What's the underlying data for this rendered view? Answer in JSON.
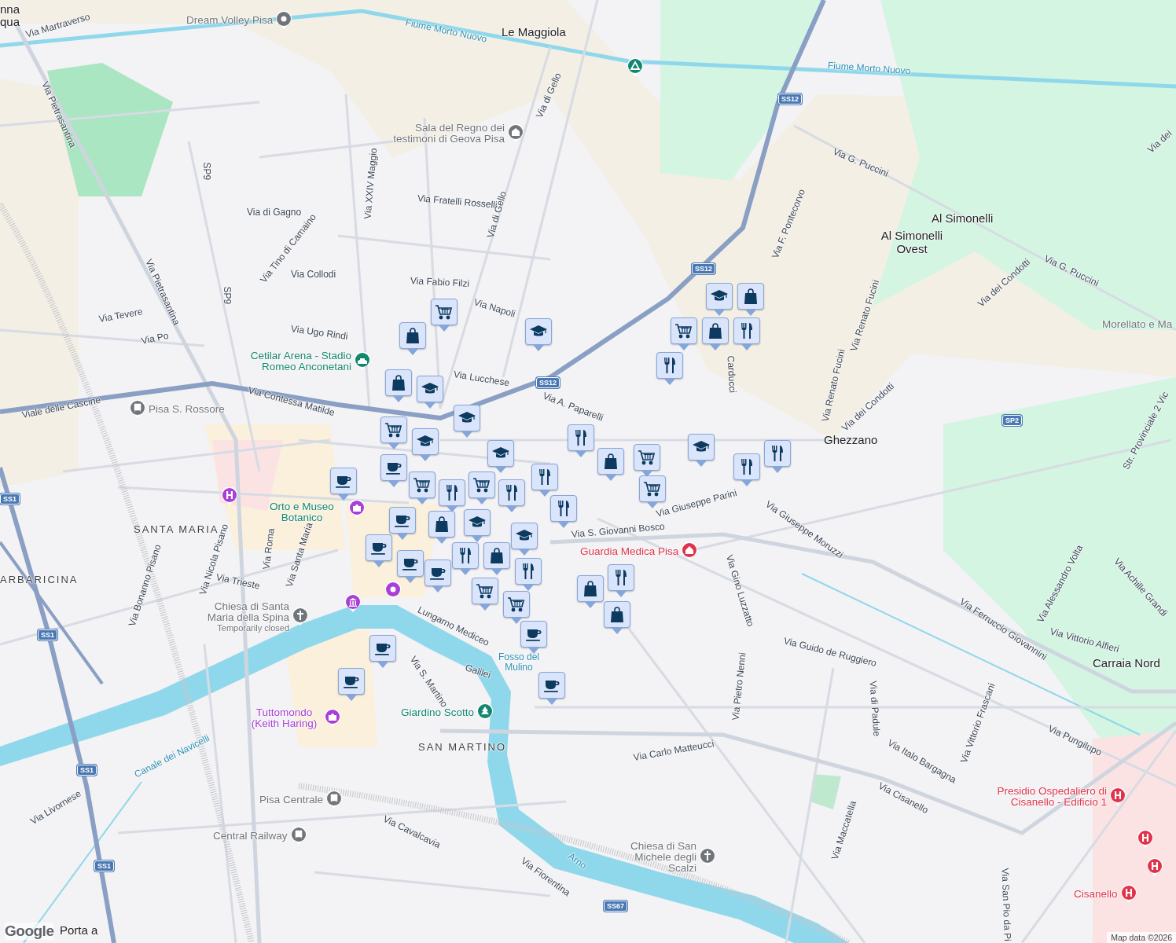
{
  "map": {
    "labels": [
      {
        "text": "Via Martraverso",
        "kind": "street"
      },
      {
        "text": "Via Pietrasantina",
        "kind": "street"
      },
      {
        "text": "SP9",
        "kind": "street"
      },
      {
        "text": "Via di Gagno",
        "kind": "street"
      },
      {
        "text": "Via Tino di Camaino",
        "kind": "street"
      },
      {
        "text": "SP9",
        "kind": "street"
      },
      {
        "text": "Via Collodi",
        "kind": "street"
      },
      {
        "text": "Via Pietrasantina",
        "kind": "street"
      },
      {
        "text": "Via Tevere",
        "kind": "street"
      },
      {
        "text": "Via Po",
        "kind": "street"
      },
      {
        "text": "Via Ugo Rindi",
        "kind": "street"
      },
      {
        "text": "Via XXIV Maggio",
        "kind": "street"
      },
      {
        "text": "Via Fratelli Rosselli",
        "kind": "street"
      },
      {
        "text": "Via Fabio Filzi",
        "kind": "street"
      },
      {
        "text": "Via di Gello",
        "kind": "street"
      },
      {
        "text": "Via di Gello",
        "kind": "street"
      },
      {
        "text": "Via Napoli",
        "kind": "street"
      },
      {
        "text": "Via Lucchese",
        "kind": "street"
      },
      {
        "text": "Via Contessa Matilde",
        "kind": "street"
      },
      {
        "text": "Viale delle Cascine",
        "kind": "street"
      },
      {
        "text": "Via A. Paparelli",
        "kind": "street"
      },
      {
        "text": "Via G. Puccini",
        "kind": "street"
      },
      {
        "text": "Via F. Pontecorvo",
        "kind": "street"
      },
      {
        "text": "Via Renato Fucini",
        "kind": "street"
      },
      {
        "text": "Via Renato Fucini",
        "kind": "street"
      },
      {
        "text": "Via dei Condotti",
        "kind": "street"
      },
      {
        "text": "Via dei Condotti",
        "kind": "street"
      },
      {
        "text": "Via G. Puccini",
        "kind": "street"
      },
      {
        "text": "Via dei",
        "kind": "street"
      },
      {
        "text": "Str. Provinciale 2 Vic",
        "kind": "street"
      },
      {
        "text": "Carducci",
        "kind": "street"
      },
      {
        "text": "Via Giuseppe Parini",
        "kind": "street"
      },
      {
        "text": "Via S. Giovanni Bosco",
        "kind": "street"
      },
      {
        "text": "Via Giuseppe Moruzzi",
        "kind": "street"
      },
      {
        "text": "Via Gino Luzzatto",
        "kind": "street"
      },
      {
        "text": "Via Pietro Nenni",
        "kind": "street"
      },
      {
        "text": "Via Guido de Ruggiero",
        "kind": "street"
      },
      {
        "text": "Via di Padule",
        "kind": "street"
      },
      {
        "text": "Via Ferruccio Giovannini",
        "kind": "street"
      },
      {
        "text": "Via Alessandro Volta",
        "kind": "street"
      },
      {
        "text": "Via Achille Grandi",
        "kind": "street"
      },
      {
        "text": "Via Vittorio Alfieri",
        "kind": "street"
      },
      {
        "text": "Via Vittorio Frascani",
        "kind": "street"
      },
      {
        "text": "Via Pungilupo",
        "kind": "street"
      },
      {
        "text": "Via Italo Bargagna",
        "kind": "street"
      },
      {
        "text": "Via Carlo Matteucci",
        "kind": "street"
      },
      {
        "text": "Via Cisanello",
        "kind": "street"
      },
      {
        "text": "Via Maccatella",
        "kind": "street"
      },
      {
        "text": "Via San Pio da Pi",
        "kind": "street"
      },
      {
        "text": "Via Bonanno Pisano",
        "kind": "street"
      },
      {
        "text": "Via Nicola Pisano",
        "kind": "street"
      },
      {
        "text": "Via Roma",
        "kind": "street"
      },
      {
        "text": "Via Santa Maria",
        "kind": "street"
      },
      {
        "text": "Via Trieste",
        "kind": "street"
      },
      {
        "text": "Lungarno Mediceo",
        "kind": "street"
      },
      {
        "text": "Galilei",
        "kind": "street"
      },
      {
        "text": "Via S. Martino",
        "kind": "street"
      },
      {
        "text": "Via Livornese",
        "kind": "street"
      },
      {
        "text": "Via Cavalcavia",
        "kind": "street"
      },
      {
        "text": "Via Fiorentina",
        "kind": "street"
      },
      {
        "text": "Canale dei Navicelli",
        "kind": "water"
      },
      {
        "text": "Arno",
        "kind": "water"
      },
      {
        "text": "Fiume Morto Nuovo",
        "kind": "water"
      },
      {
        "text": "Fiume Morto Nuovo",
        "kind": "water"
      },
      {
        "text": "Le Maggiola",
        "kind": "locality"
      },
      {
        "text": "Al Simonelli",
        "kind": "locality"
      },
      {
        "text": "Al Simonelli Ovest",
        "kind": "locality"
      },
      {
        "text": "Ghezzano",
        "kind": "locality"
      },
      {
        "text": "Carraia Nord",
        "kind": "locality"
      },
      {
        "text": "Porta a",
        "kind": "locality"
      },
      {
        "text": "nna",
        "kind": "locality"
      },
      {
        "text": "qua",
        "kind": "locality"
      },
      {
        "text": "SANTA MARIA",
        "kind": "district"
      },
      {
        "text": "ARBARICINA",
        "kind": "district"
      },
      {
        "text": "Fosso del Mulino",
        "kind": "water"
      },
      {
        "text": "SAN MARTINO",
        "kind": "district"
      }
    ],
    "road_shields": [
      "SS12",
      "SS12",
      "SS12",
      "SP2",
      "SS1",
      "SS1",
      "SS1",
      "SS1",
      "SS67"
    ],
    "pois": [
      {
        "name": "Dream Volley Pisa",
        "kind": "pin",
        "color": "#70757a"
      },
      {
        "name": "Sala del Regno dei testimoni di Geova Pisa",
        "kind": "worship",
        "color": "#70757a"
      },
      {
        "name": "Cetilar Arena - Stadio Romeo Anconetani",
        "kind": "stadium",
        "color": "#12876f"
      },
      {
        "name": "Pisa S. Rossore",
        "kind": "train",
        "color": "#70757a"
      },
      {
        "name": "Orto e Museo Botanico",
        "kind": "none",
        "color": "#12876f"
      },
      {
        "name": "Guardia Medica Pisa",
        "kind": "medical",
        "color": "#e0334a"
      },
      {
        "name": "Chiesa di Santa Maria della Spina",
        "kind": "church",
        "color": "#70757a",
        "note": "Temporarily closed"
      },
      {
        "name": "Tuttomondo (Keith Haring)",
        "kind": "camera",
        "color": "#a83fd6"
      },
      {
        "name": "Giardino Scotto",
        "kind": "park",
        "color": "#12876f"
      },
      {
        "name": "Pisa Centrale",
        "kind": "train",
        "color": "#70757a"
      },
      {
        "name": "Central Railway",
        "kind": "train",
        "color": "#70757a"
      },
      {
        "name": "Chiesa di San Michele degli Scalzi",
        "kind": "church",
        "color": "#70757a"
      },
      {
        "name": "Presidio Ospedaliero di Cisanello - Edificio 1",
        "kind": "hospital",
        "color": "#e0334a"
      },
      {
        "name": "Cisanello",
        "kind": "hospital",
        "color": "#e0334a"
      },
      {
        "name": "Morellato e Ma",
        "kind": "none",
        "color": "#70757a"
      }
    ],
    "place_icons": [
      {
        "kind": "camping",
        "color": "#12876f"
      },
      {
        "kind": "museum",
        "color": "#a83fd6"
      },
      {
        "kind": "camera",
        "color": "#a83fd6"
      },
      {
        "kind": "hospital",
        "color": "#a83fd6"
      },
      {
        "kind": "hospital",
        "color": "#e0334a"
      },
      {
        "kind": "hospital",
        "color": "#e0334a"
      },
      {
        "kind": "pin",
        "color": "#a83fd6"
      }
    ],
    "markers": [
      {
        "kind": "grocery"
      },
      {
        "kind": "shopping"
      },
      {
        "kind": "school"
      },
      {
        "kind": "shopping"
      },
      {
        "kind": "school"
      },
      {
        "kind": "school"
      },
      {
        "kind": "grocery"
      },
      {
        "kind": "school"
      },
      {
        "kind": "cafe"
      },
      {
        "kind": "grocery"
      },
      {
        "kind": "restaurant"
      },
      {
        "kind": "cafe"
      },
      {
        "kind": "grocery"
      },
      {
        "kind": "school"
      },
      {
        "kind": "restaurant"
      },
      {
        "kind": "shopping"
      },
      {
        "kind": "cafe"
      },
      {
        "kind": "school"
      },
      {
        "kind": "school"
      },
      {
        "kind": "restaurant"
      },
      {
        "kind": "cafe"
      },
      {
        "kind": "cafe"
      },
      {
        "kind": "cafe"
      },
      {
        "kind": "shopping"
      },
      {
        "kind": "restaurant"
      },
      {
        "kind": "grocery"
      },
      {
        "kind": "grocery"
      },
      {
        "kind": "cafe"
      },
      {
        "kind": "cafe"
      },
      {
        "kind": "cafe"
      },
      {
        "kind": "cafe"
      },
      {
        "kind": "restaurant"
      },
      {
        "kind": "restaurant"
      },
      {
        "kind": "restaurant"
      },
      {
        "kind": "shopping"
      },
      {
        "kind": "grocery"
      },
      {
        "kind": "grocery"
      },
      {
        "kind": "school"
      },
      {
        "kind": "restaurant"
      },
      {
        "kind": "grocery"
      },
      {
        "kind": "shopping"
      },
      {
        "kind": "restaurant"
      },
      {
        "kind": "school"
      },
      {
        "kind": "shopping"
      },
      {
        "kind": "restaurant"
      },
      {
        "kind": "restaurant"
      },
      {
        "kind": "shopping"
      },
      {
        "kind": "restaurant"
      },
      {
        "kind": "shopping"
      }
    ]
  },
  "attribution": {
    "logo": "Google",
    "map_data": "Map data ©2026"
  }
}
